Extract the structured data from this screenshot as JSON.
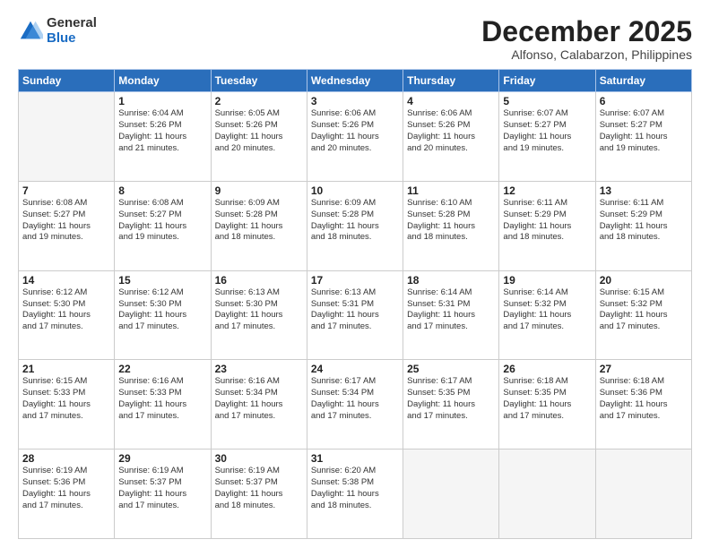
{
  "header": {
    "logo_general": "General",
    "logo_blue": "Blue",
    "month_title": "December 2025",
    "subtitle": "Alfonso, Calabarzon, Philippines"
  },
  "weekdays": [
    "Sunday",
    "Monday",
    "Tuesday",
    "Wednesday",
    "Thursday",
    "Friday",
    "Saturday"
  ],
  "weeks": [
    [
      {
        "day": "",
        "info": ""
      },
      {
        "day": "1",
        "info": "Sunrise: 6:04 AM\nSunset: 5:26 PM\nDaylight: 11 hours\nand 21 minutes."
      },
      {
        "day": "2",
        "info": "Sunrise: 6:05 AM\nSunset: 5:26 PM\nDaylight: 11 hours\nand 20 minutes."
      },
      {
        "day": "3",
        "info": "Sunrise: 6:06 AM\nSunset: 5:26 PM\nDaylight: 11 hours\nand 20 minutes."
      },
      {
        "day": "4",
        "info": "Sunrise: 6:06 AM\nSunset: 5:26 PM\nDaylight: 11 hours\nand 20 minutes."
      },
      {
        "day": "5",
        "info": "Sunrise: 6:07 AM\nSunset: 5:27 PM\nDaylight: 11 hours\nand 19 minutes."
      },
      {
        "day": "6",
        "info": "Sunrise: 6:07 AM\nSunset: 5:27 PM\nDaylight: 11 hours\nand 19 minutes."
      }
    ],
    [
      {
        "day": "7",
        "info": "Sunrise: 6:08 AM\nSunset: 5:27 PM\nDaylight: 11 hours\nand 19 minutes."
      },
      {
        "day": "8",
        "info": "Sunrise: 6:08 AM\nSunset: 5:27 PM\nDaylight: 11 hours\nand 19 minutes."
      },
      {
        "day": "9",
        "info": "Sunrise: 6:09 AM\nSunset: 5:28 PM\nDaylight: 11 hours\nand 18 minutes."
      },
      {
        "day": "10",
        "info": "Sunrise: 6:09 AM\nSunset: 5:28 PM\nDaylight: 11 hours\nand 18 minutes."
      },
      {
        "day": "11",
        "info": "Sunrise: 6:10 AM\nSunset: 5:28 PM\nDaylight: 11 hours\nand 18 minutes."
      },
      {
        "day": "12",
        "info": "Sunrise: 6:11 AM\nSunset: 5:29 PM\nDaylight: 11 hours\nand 18 minutes."
      },
      {
        "day": "13",
        "info": "Sunrise: 6:11 AM\nSunset: 5:29 PM\nDaylight: 11 hours\nand 18 minutes."
      }
    ],
    [
      {
        "day": "14",
        "info": "Sunrise: 6:12 AM\nSunset: 5:30 PM\nDaylight: 11 hours\nand 17 minutes."
      },
      {
        "day": "15",
        "info": "Sunrise: 6:12 AM\nSunset: 5:30 PM\nDaylight: 11 hours\nand 17 minutes."
      },
      {
        "day": "16",
        "info": "Sunrise: 6:13 AM\nSunset: 5:30 PM\nDaylight: 11 hours\nand 17 minutes."
      },
      {
        "day": "17",
        "info": "Sunrise: 6:13 AM\nSunset: 5:31 PM\nDaylight: 11 hours\nand 17 minutes."
      },
      {
        "day": "18",
        "info": "Sunrise: 6:14 AM\nSunset: 5:31 PM\nDaylight: 11 hours\nand 17 minutes."
      },
      {
        "day": "19",
        "info": "Sunrise: 6:14 AM\nSunset: 5:32 PM\nDaylight: 11 hours\nand 17 minutes."
      },
      {
        "day": "20",
        "info": "Sunrise: 6:15 AM\nSunset: 5:32 PM\nDaylight: 11 hours\nand 17 minutes."
      }
    ],
    [
      {
        "day": "21",
        "info": "Sunrise: 6:15 AM\nSunset: 5:33 PM\nDaylight: 11 hours\nand 17 minutes."
      },
      {
        "day": "22",
        "info": "Sunrise: 6:16 AM\nSunset: 5:33 PM\nDaylight: 11 hours\nand 17 minutes."
      },
      {
        "day": "23",
        "info": "Sunrise: 6:16 AM\nSunset: 5:34 PM\nDaylight: 11 hours\nand 17 minutes."
      },
      {
        "day": "24",
        "info": "Sunrise: 6:17 AM\nSunset: 5:34 PM\nDaylight: 11 hours\nand 17 minutes."
      },
      {
        "day": "25",
        "info": "Sunrise: 6:17 AM\nSunset: 5:35 PM\nDaylight: 11 hours\nand 17 minutes."
      },
      {
        "day": "26",
        "info": "Sunrise: 6:18 AM\nSunset: 5:35 PM\nDaylight: 11 hours\nand 17 minutes."
      },
      {
        "day": "27",
        "info": "Sunrise: 6:18 AM\nSunset: 5:36 PM\nDaylight: 11 hours\nand 17 minutes."
      }
    ],
    [
      {
        "day": "28",
        "info": "Sunrise: 6:19 AM\nSunset: 5:36 PM\nDaylight: 11 hours\nand 17 minutes."
      },
      {
        "day": "29",
        "info": "Sunrise: 6:19 AM\nSunset: 5:37 PM\nDaylight: 11 hours\nand 17 minutes."
      },
      {
        "day": "30",
        "info": "Sunrise: 6:19 AM\nSunset: 5:37 PM\nDaylight: 11 hours\nand 18 minutes."
      },
      {
        "day": "31",
        "info": "Sunrise: 6:20 AM\nSunset: 5:38 PM\nDaylight: 11 hours\nand 18 minutes."
      },
      {
        "day": "",
        "info": ""
      },
      {
        "day": "",
        "info": ""
      },
      {
        "day": "",
        "info": ""
      }
    ]
  ]
}
